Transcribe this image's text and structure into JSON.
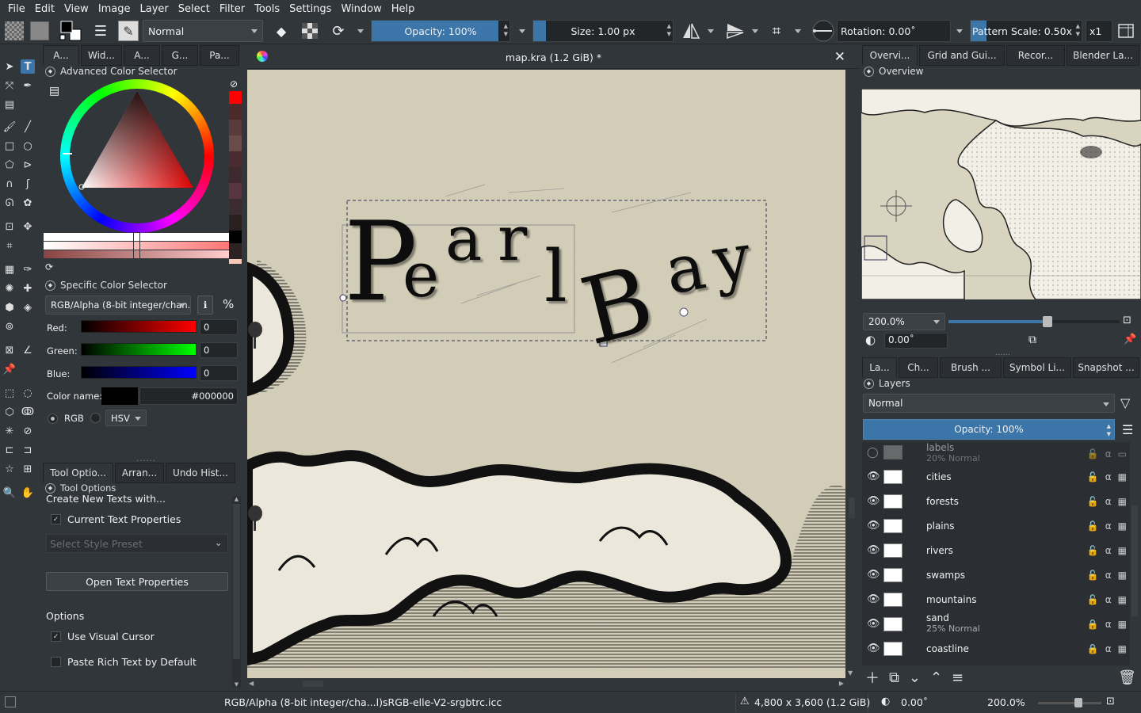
{
  "menu": [
    "File",
    "Edit",
    "View",
    "Image",
    "Layer",
    "Select",
    "Filter",
    "Tools",
    "Settings",
    "Window",
    "Help"
  ],
  "toolbar": {
    "blend_mode": "Normal",
    "opacity": "Opacity: 100%",
    "size": "Size: 1.00 px",
    "rotation": "Rotation: 0.00˚",
    "pattern_scale": "Pattern Scale: 0.50x",
    "zoom_factor": "x1",
    "opacity_fraction": 1.0,
    "pattern_scale_fraction": 0.14
  },
  "left_dock_tabs": [
    "A...",
    "Wid...",
    "A...",
    "G...",
    "Pa..."
  ],
  "color_selector": {
    "title": "Advanced Color Selector",
    "specific_title": "Specific Color Selector",
    "model": "RGB/Alpha (8-bit integer/chan...",
    "percent_symbol": "%",
    "channels": [
      {
        "label": "Red:",
        "value": "0"
      },
      {
        "label": "Green:",
        "value": "0"
      },
      {
        "label": "Blue:",
        "value": "0"
      }
    ],
    "color_name_label": "Color name:",
    "hex": "#000000",
    "rgb_label": "RGB",
    "hsv_label": "HSV"
  },
  "tool_tabs": [
    "Tool Optio...",
    "Arran...",
    "Undo Hist..."
  ],
  "tool_options": {
    "title": "Tool Options",
    "create_label": "Create New Texts with...",
    "current_text_properties": "Current Text Properties",
    "style_preset_placeholder": "Select Style Preset",
    "open_text_props": "Open Text Properties",
    "options_heading": "Options",
    "use_visual_cursor": "Use Visual Cursor",
    "paste_rich_text": "Paste Rich Text by Default"
  },
  "document": {
    "title": "map.kra (1.2 GiB) *",
    "canvas_text": "Pearl Bay"
  },
  "right_top_tabs": [
    "Overvi...",
    "Grid and Gui...",
    "Recor...",
    "Blender La..."
  ],
  "overview": {
    "title": "Overview",
    "zoom": "200.0%",
    "rotation": "0.00˚",
    "zoom_fraction": 0.58
  },
  "right_bottom_tabs": [
    "La...",
    "Ch...",
    "Brush ...",
    "Symbol Li...",
    "Snapshot ..."
  ],
  "layers": {
    "title": "Layers",
    "blend_mode": "Normal",
    "opacity": "Opacity: 100%",
    "items": [
      {
        "name": "labels",
        "sub": "20% Normal",
        "visible": false
      },
      {
        "name": "cities",
        "sub": "",
        "visible": true
      },
      {
        "name": "forests",
        "sub": "",
        "visible": true
      },
      {
        "name": "plains",
        "sub": "",
        "visible": true
      },
      {
        "name": "rivers",
        "sub": "",
        "visible": true
      },
      {
        "name": "swamps",
        "sub": "",
        "visible": true
      },
      {
        "name": "mountains",
        "sub": "",
        "visible": true
      },
      {
        "name": "sand",
        "sub": "25% Normal",
        "visible": true
      },
      {
        "name": "coastline",
        "sub": "",
        "visible": true
      }
    ]
  },
  "status": {
    "color_space": "RGB/Alpha (8-bit integer/cha...l)",
    "profile": "sRGB-elle-V2-srgbtrc.icc",
    "dimensions": "4,800 x 3,600 (1.2 GiB)",
    "rotation": "0.00˚",
    "zoom": "200.0%"
  },
  "colors": {
    "accent": "#3c75a8",
    "bg": "#31363b",
    "paper": "#d9d4c0"
  }
}
